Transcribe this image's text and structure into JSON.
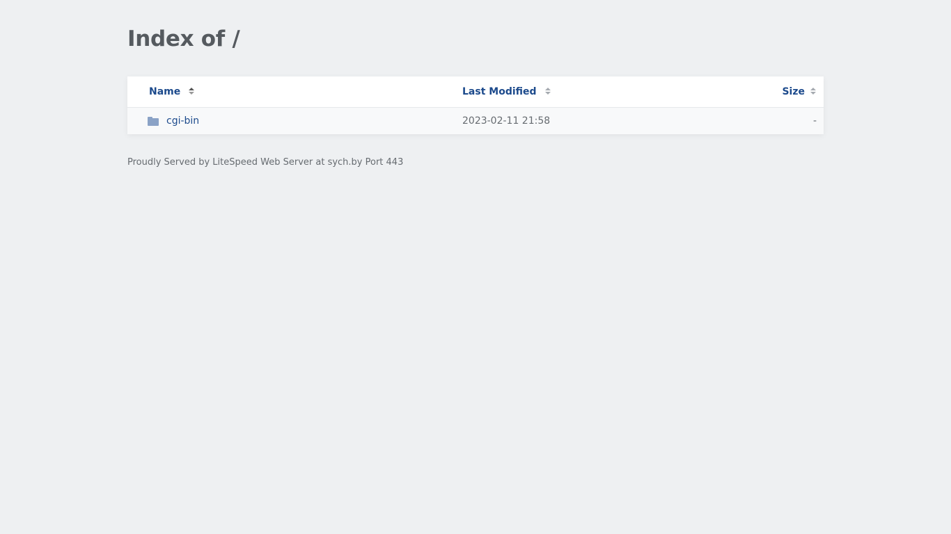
{
  "page": {
    "title": "Index of /"
  },
  "table": {
    "columns": [
      {
        "label": "Name"
      },
      {
        "label": "Last Modified"
      },
      {
        "label": "Size"
      }
    ],
    "rows": [
      {
        "name": "cgi-bin",
        "icon": "folder-icon",
        "modified": "2023-02-11 21:58",
        "size": "-"
      }
    ]
  },
  "footer": {
    "text": "Proudly Served by LiteSpeed Web Server at sych.by Port 443"
  },
  "colors": {
    "background": "#eef0f2",
    "link": "#1c4a8c",
    "folder": "#8aa2c6"
  }
}
